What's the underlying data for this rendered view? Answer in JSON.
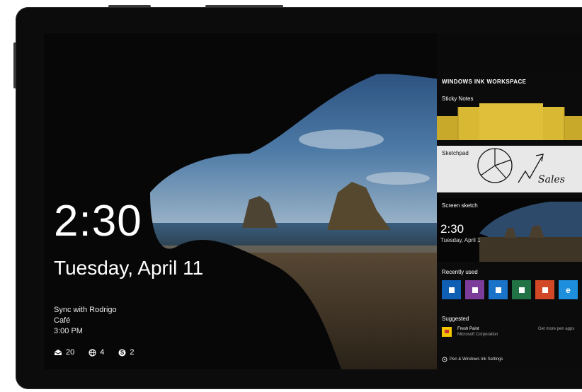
{
  "lockscreen": {
    "time": "2:30",
    "date": "Tuesday, April 11",
    "event_title": "Sync with Rodrigo",
    "event_location": "Café",
    "event_time": "3:00 PM",
    "badges": [
      {
        "icon": "mail-icon",
        "count": "20"
      },
      {
        "icon": "globe-icon",
        "count": "4"
      },
      {
        "icon": "skype-icon",
        "count": "2"
      }
    ]
  },
  "ink_workspace": {
    "title": "WINDOWS INK WORKSPACE",
    "sticky_notes_label": "Sticky Notes",
    "sketchpad_label": "Sketchpad",
    "sketch_text": "Sales",
    "screen_sketch_label": "Screen sketch",
    "screen_sketch_time": "2:30",
    "screen_sketch_date": "Tuesday, April 1",
    "recently_used_label": "Recently used",
    "recent_apps": [
      {
        "icon": "outlook-icon",
        "color": "#0f5fb5",
        "glyph": "▪"
      },
      {
        "icon": "onenote-icon",
        "color": "#7b3c9a",
        "glyph": "▪"
      },
      {
        "icon": "teams-icon",
        "color": "#1a73c9",
        "glyph": "▪"
      },
      {
        "icon": "excel-icon",
        "color": "#217346",
        "glyph": "▪"
      },
      {
        "icon": "powerpoint-icon",
        "color": "#d24726",
        "glyph": "▪"
      },
      {
        "icon": "edge-icon",
        "color": "#1e8fdc",
        "glyph": "e"
      }
    ],
    "suggested_label": "Suggested",
    "suggested_app_name": "Fresh Paint",
    "suggested_app_publisher": "Microsoft Corporation",
    "get_more_label": "Get more pen apps",
    "settings_label": "Pen & Windows Ink Settings"
  },
  "colors": {
    "sticky_yellow": "#d4b431",
    "sketch_bg": "#e8e8e8"
  }
}
